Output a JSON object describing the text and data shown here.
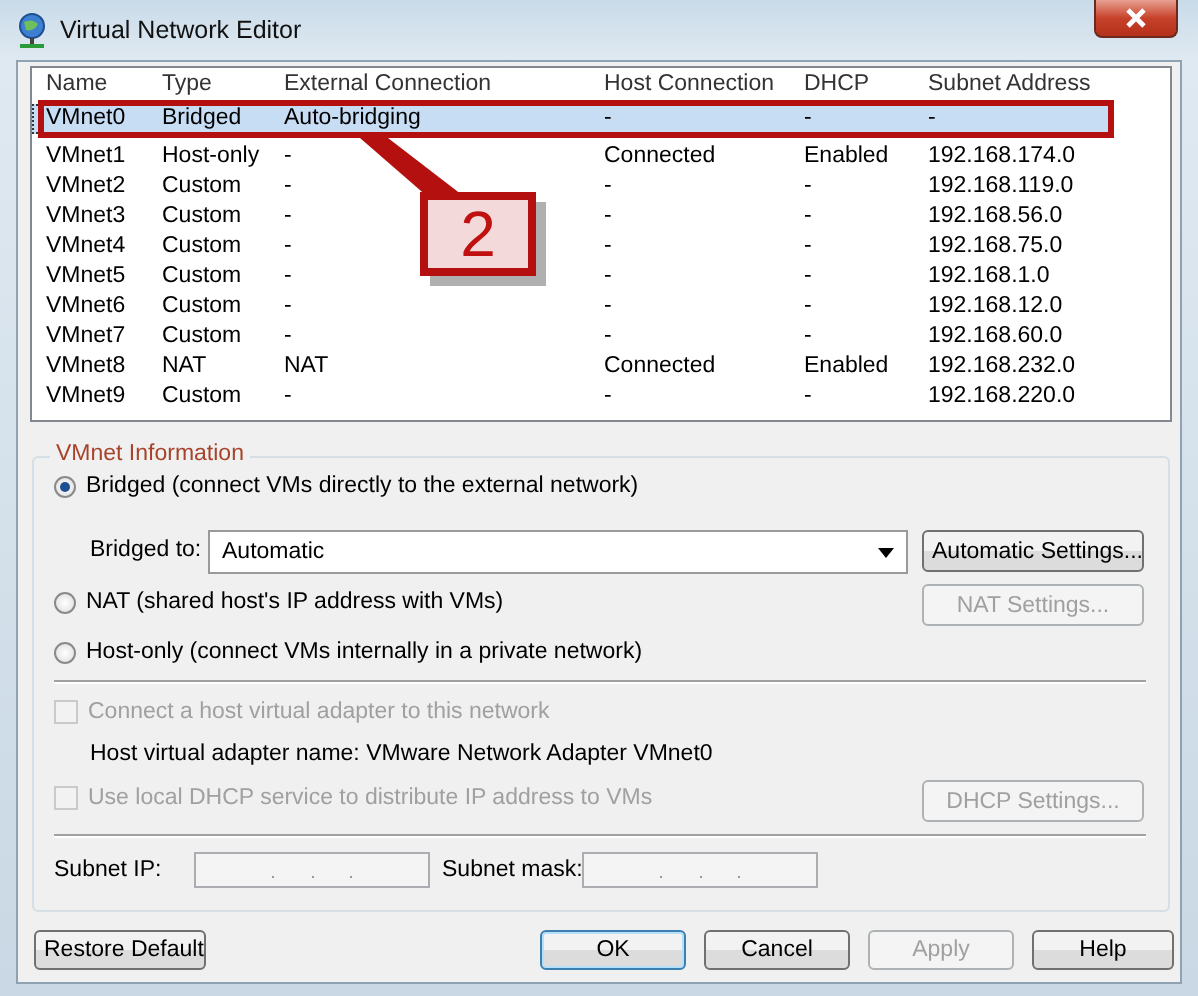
{
  "window": {
    "title": "Virtual Network Editor"
  },
  "table": {
    "columns": [
      "Name",
      "Type",
      "External Connection",
      "Host Connection",
      "DHCP",
      "Subnet Address"
    ],
    "rows": [
      {
        "cells": [
          "VMnet0",
          "Bridged",
          "Auto-bridging",
          "-",
          "-",
          "-"
        ],
        "selected": true
      },
      {
        "cells": [
          "VMnet1",
          "Host-only",
          "-",
          "Connected",
          "Enabled",
          "192.168.174.0"
        ],
        "selected": false
      },
      {
        "cells": [
          "VMnet2",
          "Custom",
          "-",
          "-",
          "-",
          "192.168.119.0"
        ],
        "selected": false
      },
      {
        "cells": [
          "VMnet3",
          "Custom",
          "-",
          "-",
          "-",
          "192.168.56.0"
        ],
        "selected": false
      },
      {
        "cells": [
          "VMnet4",
          "Custom",
          "-",
          "-",
          "-",
          "192.168.75.0"
        ],
        "selected": false
      },
      {
        "cells": [
          "VMnet5",
          "Custom",
          "-",
          "-",
          "-",
          "192.168.1.0"
        ],
        "selected": false
      },
      {
        "cells": [
          "VMnet6",
          "Custom",
          "-",
          "-",
          "-",
          "192.168.12.0"
        ],
        "selected": false
      },
      {
        "cells": [
          "VMnet7",
          "Custom",
          "-",
          "-",
          "-",
          "192.168.60.0"
        ],
        "selected": false
      },
      {
        "cells": [
          "VMnet8",
          "NAT",
          "NAT",
          "Connected",
          "Enabled",
          "192.168.232.0"
        ],
        "selected": false
      },
      {
        "cells": [
          "VMnet9",
          "Custom",
          "-",
          "-",
          "-",
          "192.168.220.0"
        ],
        "selected": false
      }
    ]
  },
  "annotation": {
    "label": "2"
  },
  "vmnet_information": {
    "title": "VMnet Information",
    "bridged": {
      "label": "Bridged (connect VMs directly to the external network)",
      "selected": true
    },
    "bridged_to": {
      "label": "Bridged to:",
      "value": "Automatic"
    },
    "automatic_settings": {
      "label": "Automatic Settings...",
      "disabled": false
    },
    "nat": {
      "label": "NAT (shared host's IP address with VMs)",
      "selected": false
    },
    "nat_settings": {
      "label": "NAT Settings...",
      "disabled": true
    },
    "host_only": {
      "label": "Host-only (connect VMs internally in a private network)",
      "selected": false
    },
    "connect_adapter": {
      "label": "Connect a host virtual adapter to this network",
      "checked": false,
      "disabled": true
    },
    "adapter_name": "Host virtual adapter name: VMware Network Adapter VMnet0",
    "use_dhcp": {
      "label": "Use local DHCP service to distribute IP address to VMs",
      "checked": false,
      "disabled": true
    },
    "dhcp_settings": {
      "label": "DHCP Settings...",
      "disabled": true
    },
    "subnet_ip": {
      "label": "Subnet IP:"
    },
    "subnet_mask": {
      "label": "Subnet mask:"
    }
  },
  "buttons": [
    {
      "label": "Restore Default",
      "disabled": false,
      "default": false
    },
    {
      "label": "OK",
      "disabled": false,
      "default": true
    },
    {
      "label": "Cancel",
      "disabled": false,
      "default": false
    },
    {
      "label": "Apply",
      "disabled": true,
      "default": false
    },
    {
      "label": "Help",
      "disabled": false,
      "default": false
    }
  ]
}
